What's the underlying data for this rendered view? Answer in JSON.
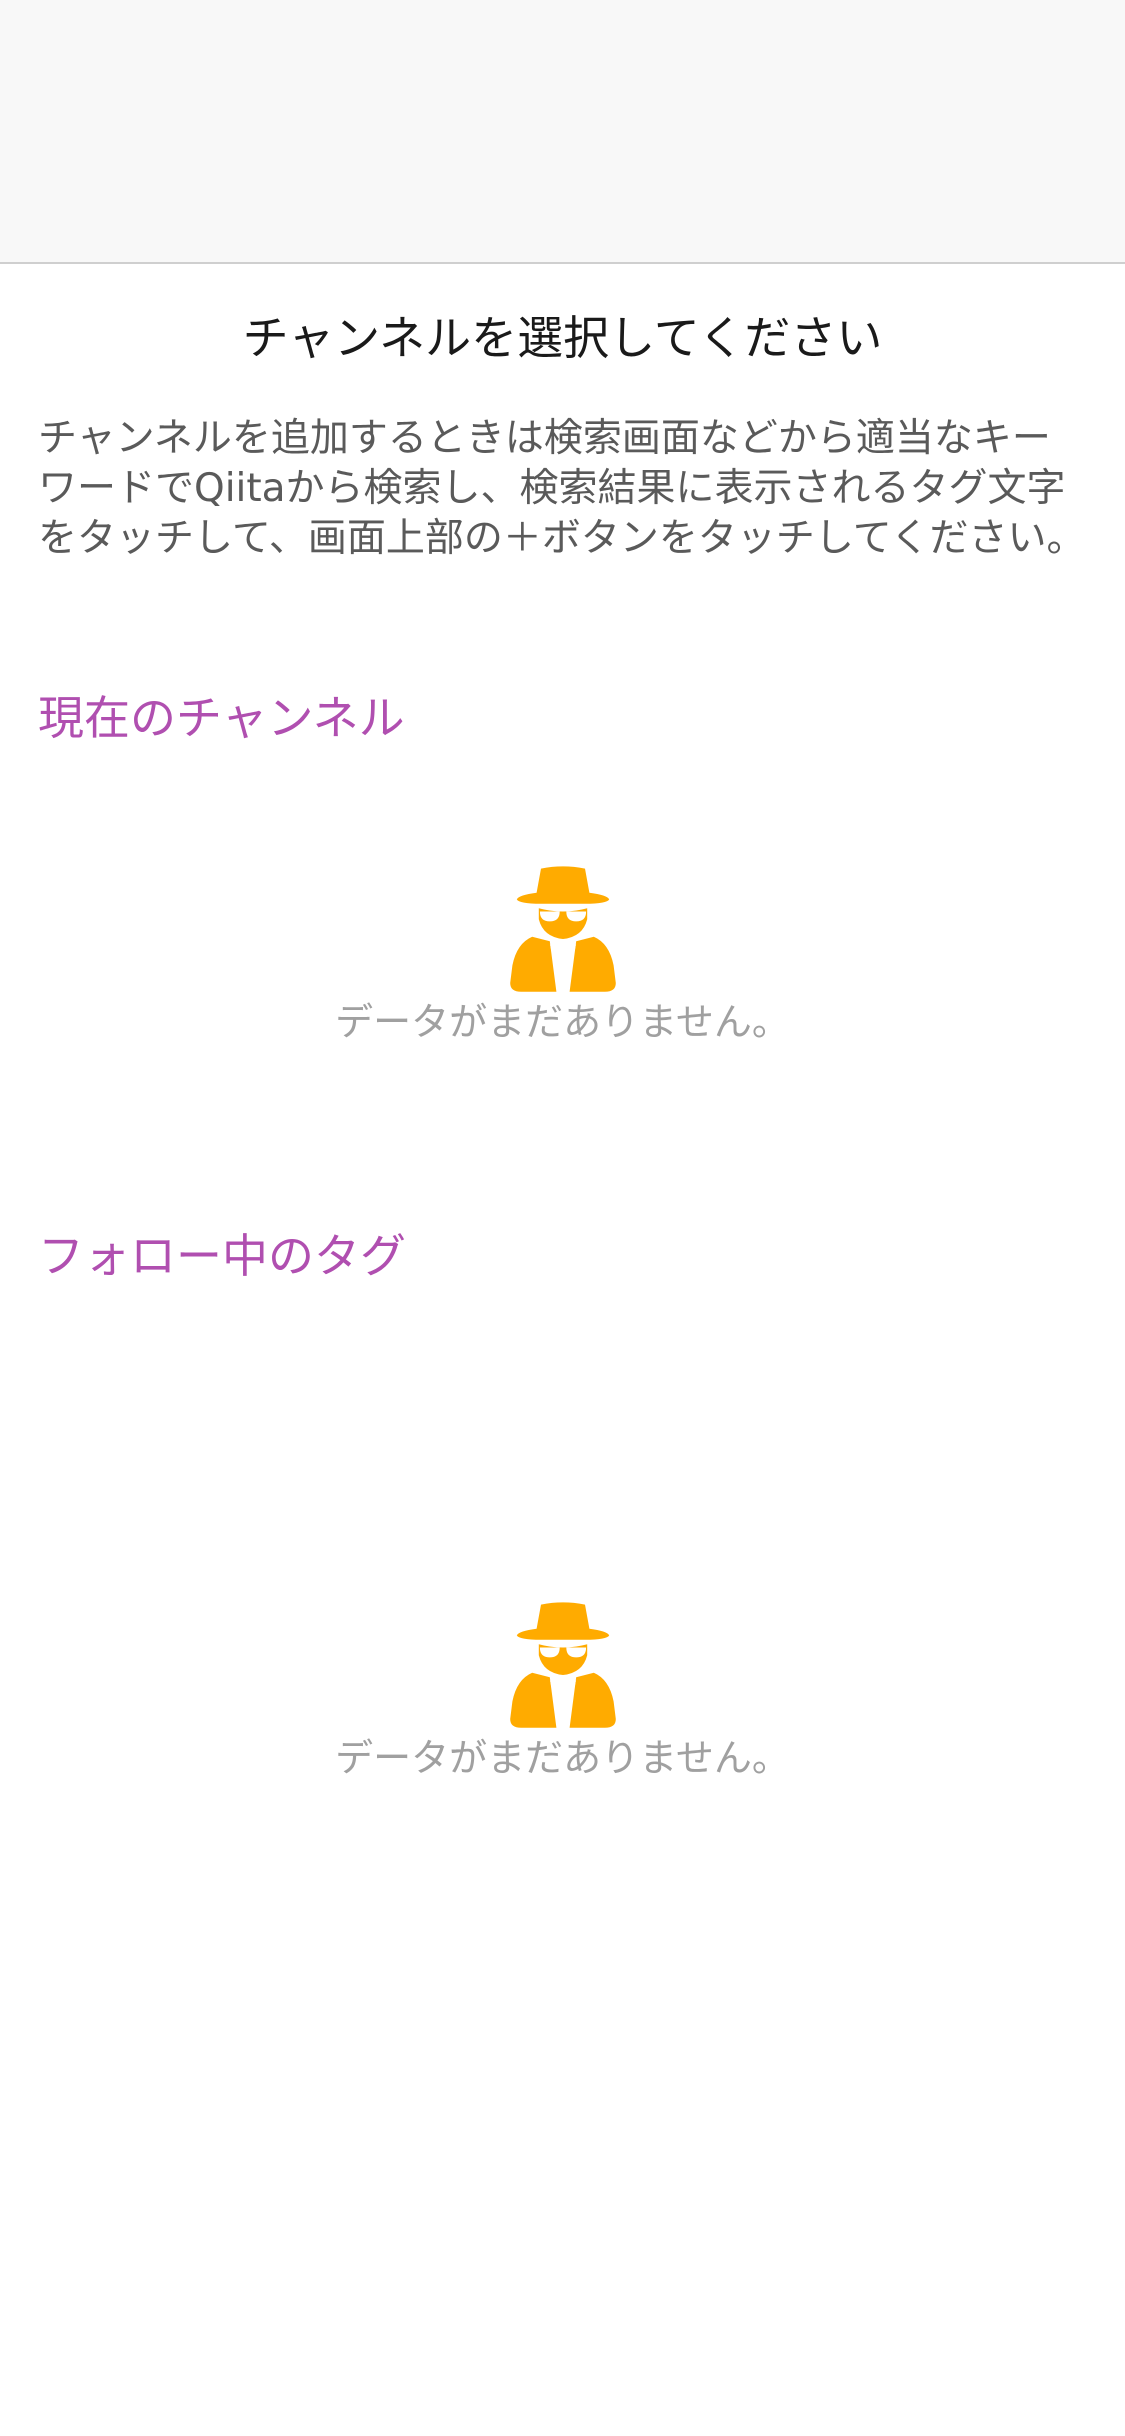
{
  "header": {
    "title": "チャンネルを選択してください"
  },
  "description": "チャンネルを追加するときは検索画面などから適当なキーワードでQiitaから検索し、検索結果に表示されるタグ文字をタッチして、画面上部の＋ボタンをタッチしてください。",
  "sections": [
    {
      "heading": "現在のチャンネル",
      "empty_text": "データがまだありません。",
      "empty_icon": "spy-icon"
    },
    {
      "heading": "フォロー中のタグ",
      "empty_text": "データがまだありません。",
      "empty_icon": "spy-icon"
    }
  ],
  "colors": {
    "accent": "#b04fb0",
    "icon": "#ffab00",
    "muted_text": "#a0a0a0"
  }
}
